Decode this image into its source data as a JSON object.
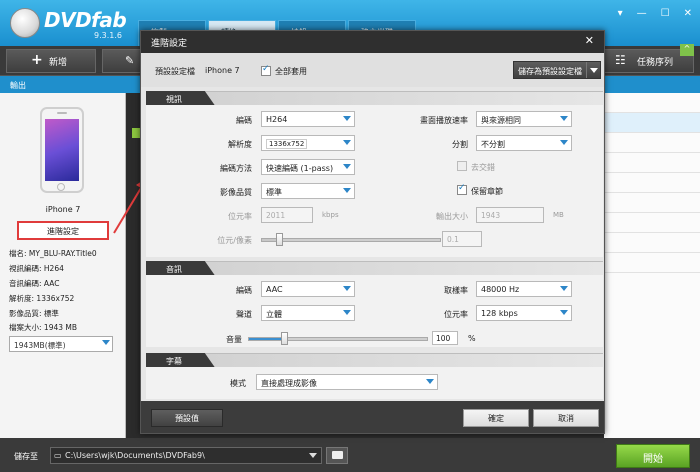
{
  "app": {
    "title": "DVDfab",
    "version": "9.3.1.6"
  },
  "main_tabs": [
    "複製",
    "轉換",
    "燒錄",
    "建立光碟"
  ],
  "toolbar": {
    "add_label": "新增",
    "task_queue_label": "任務序列"
  },
  "column_header": "輸出",
  "device": {
    "name": "iPhone 7",
    "advanced_button": "進階設定"
  },
  "file_info": [
    {
      "label": "檔名:",
      "value": "MY_BLU-RAY.Title0"
    },
    {
      "label": "視訊編碼:",
      "value": "H264"
    },
    {
      "label": "音訊編碼:",
      "value": "AAC"
    },
    {
      "label": "解析度:",
      "value": "1336x752"
    },
    {
      "label": "影像品質:",
      "value": "標準"
    },
    {
      "label": "檔案大小:",
      "value": "1943 MB"
    }
  ],
  "size_select": "1943MB(標準)",
  "bottom": {
    "save_to_label": "儲存至",
    "path": "C:\\Users\\wjk\\Documents\\DVDFab9\\",
    "start_label": "開始"
  },
  "dialog": {
    "title": "進階設定",
    "close_label": "✕",
    "preset_label": "預設設定檔",
    "preset_value": "iPhone 7",
    "apply_all_label": "全部套用",
    "apply_all_checked": true,
    "save_preset_label": "儲存為預設設定檔",
    "video": {
      "section": "視訊",
      "codec_label": "編碼",
      "codec": "H264",
      "resolution_label": "解析度",
      "resolution": "1336x752",
      "encode_method_label": "編碼方法",
      "encode_method": "快速編碼 (1-pass)",
      "quality_label": "影像品質",
      "quality": "標準",
      "bitrate_label": "位元率",
      "bitrate": "2011",
      "bitrate_unit": "kbps",
      "bits_per_pixel_label": "位元/像素",
      "bits_per_pixel": "0.1",
      "bits_per_pixel_level": 0.1,
      "framerate_label": "畫面播放速率",
      "framerate": "與來源相同",
      "split_label": "分割",
      "split": "不分割",
      "deinterlace_label": "去交錯",
      "deinterlace_checked": false,
      "keep_chapters_label": "保留章節",
      "keep_chapters_checked": true,
      "output_size_label": "輸出大小",
      "output_size": "1943",
      "output_size_unit": "MB"
    },
    "audio": {
      "section": "音訊",
      "codec_label": "編碼",
      "codec": "AAC",
      "channels_label": "聲道",
      "channels": "立體",
      "samplerate_label": "取樣率",
      "samplerate": "48000 Hz",
      "bitrate_label": "位元率",
      "bitrate": "128 kbps",
      "volume_label": "音量",
      "volume": "100",
      "volume_unit": "%",
      "volume_level": 0.2
    },
    "subtitle": {
      "section": "字幕",
      "mode_label": "模式",
      "mode": "直接處理成影像"
    },
    "footer": {
      "default_label": "預設值",
      "ok_label": "確定",
      "cancel_label": "取消"
    }
  }
}
